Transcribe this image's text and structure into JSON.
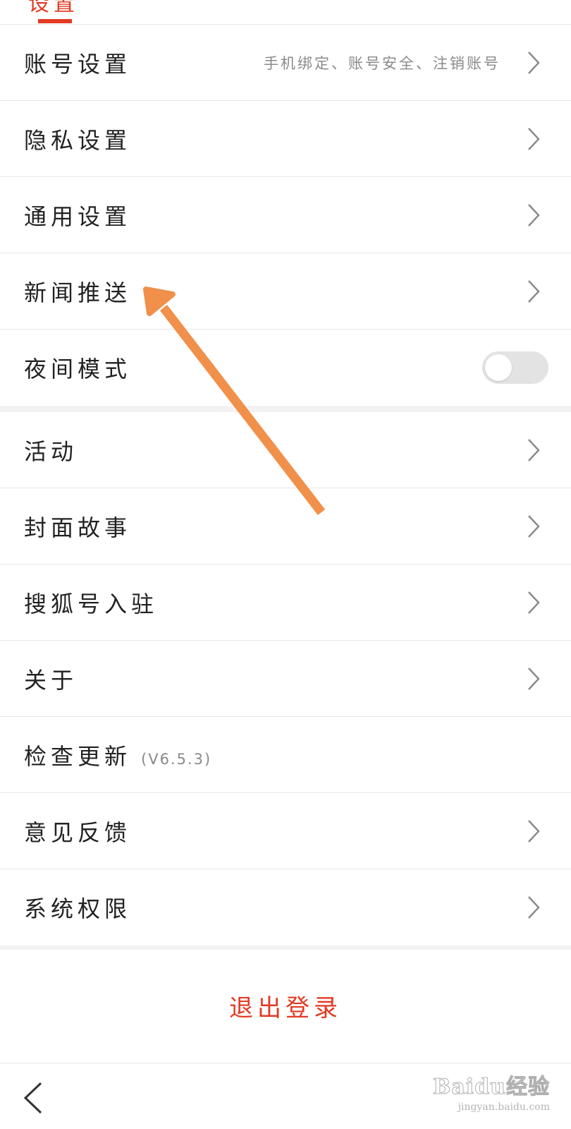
{
  "header": {
    "title": "设置"
  },
  "group1": [
    {
      "label": "账号设置",
      "desc": "手机绑定、账号安全、注销账号",
      "chevron": true
    },
    {
      "label": "隐私设置",
      "chevron": true
    },
    {
      "label": "通用设置",
      "chevron": true
    },
    {
      "label": "新闻推送",
      "chevron": true
    },
    {
      "label": "夜间模式",
      "toggle": false
    }
  ],
  "group2": [
    {
      "label": "活动",
      "chevron": true
    },
    {
      "label": "封面故事",
      "chevron": true
    },
    {
      "label": "搜狐号入驻",
      "chevron": true
    },
    {
      "label": "关于",
      "chevron": true
    },
    {
      "label": "检查更新",
      "version": "(V6.5.3)"
    },
    {
      "label": "意见反馈",
      "chevron": true
    },
    {
      "label": "系统权限",
      "chevron": true
    }
  ],
  "logout": {
    "label": "退出登录"
  },
  "bottom": {
    "back_icon": "chevron-left-icon"
  },
  "watermark": {
    "main": "Baidu经验",
    "sub": "jingyan.baidu.com"
  },
  "colors": {
    "accent": "#e23a23",
    "arrow": "#f0904a",
    "divider": "#e6e6e6",
    "background": "#f2f2f2"
  }
}
